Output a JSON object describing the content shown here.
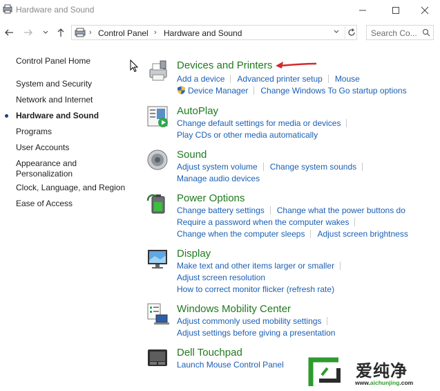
{
  "window": {
    "title": "Hardware and Sound"
  },
  "address": {
    "crumbs": [
      "Control Panel",
      "Hardware and Sound"
    ]
  },
  "search": {
    "placeholder": "Search Co..."
  },
  "sidebar": {
    "items": [
      {
        "label": "Control Panel Home"
      },
      {
        "label": "System and Security"
      },
      {
        "label": "Network and Internet"
      },
      {
        "label": "Hardware and Sound",
        "active": true
      },
      {
        "label": "Programs"
      },
      {
        "label": "User Accounts"
      },
      {
        "label": "Appearance and Personalization"
      },
      {
        "label": "Clock, Language, and Region"
      },
      {
        "label": "Ease of Access"
      }
    ]
  },
  "categories": [
    {
      "title": "Devices and Printers",
      "links": [
        [
          "Add a device",
          "Advanced printer setup",
          "Mouse"
        ],
        [
          "Device Manager",
          "Change Windows To Go startup options"
        ]
      ]
    },
    {
      "title": "AutoPlay",
      "links": [
        [
          "Change default settings for media or devices"
        ],
        [
          "Play CDs or other media automatically"
        ]
      ]
    },
    {
      "title": "Sound",
      "links": [
        [
          "Adjust system volume",
          "Change system sounds"
        ],
        [
          "Manage audio devices"
        ]
      ]
    },
    {
      "title": "Power Options",
      "links": [
        [
          "Change battery settings",
          "Change what the power buttons do"
        ],
        [
          "Require a password when the computer wakes"
        ],
        [
          "Change when the computer sleeps",
          "Adjust screen brightness"
        ]
      ]
    },
    {
      "title": "Display",
      "links": [
        [
          "Make text and other items larger or smaller"
        ],
        [
          "Adjust screen resolution"
        ],
        [
          "How to correct monitor flicker (refresh rate)"
        ]
      ]
    },
    {
      "title": "Windows Mobility Center",
      "links": [
        [
          "Adjust commonly used mobility settings"
        ],
        [
          "Adjust settings before giving a presentation"
        ]
      ]
    },
    {
      "title": "Dell Touchpad",
      "links": [
        [
          "Launch Mouse Control Panel"
        ]
      ]
    }
  ],
  "watermark": {
    "brand": "爱纯净",
    "url_prefix": "www.",
    "url_main": "aichunjing",
    "url_suffix": ".com"
  },
  "colors": {
    "category_title": "#1e7a1e",
    "link": "#1a5fb4",
    "annotation_arrow": "#d42a2a"
  }
}
